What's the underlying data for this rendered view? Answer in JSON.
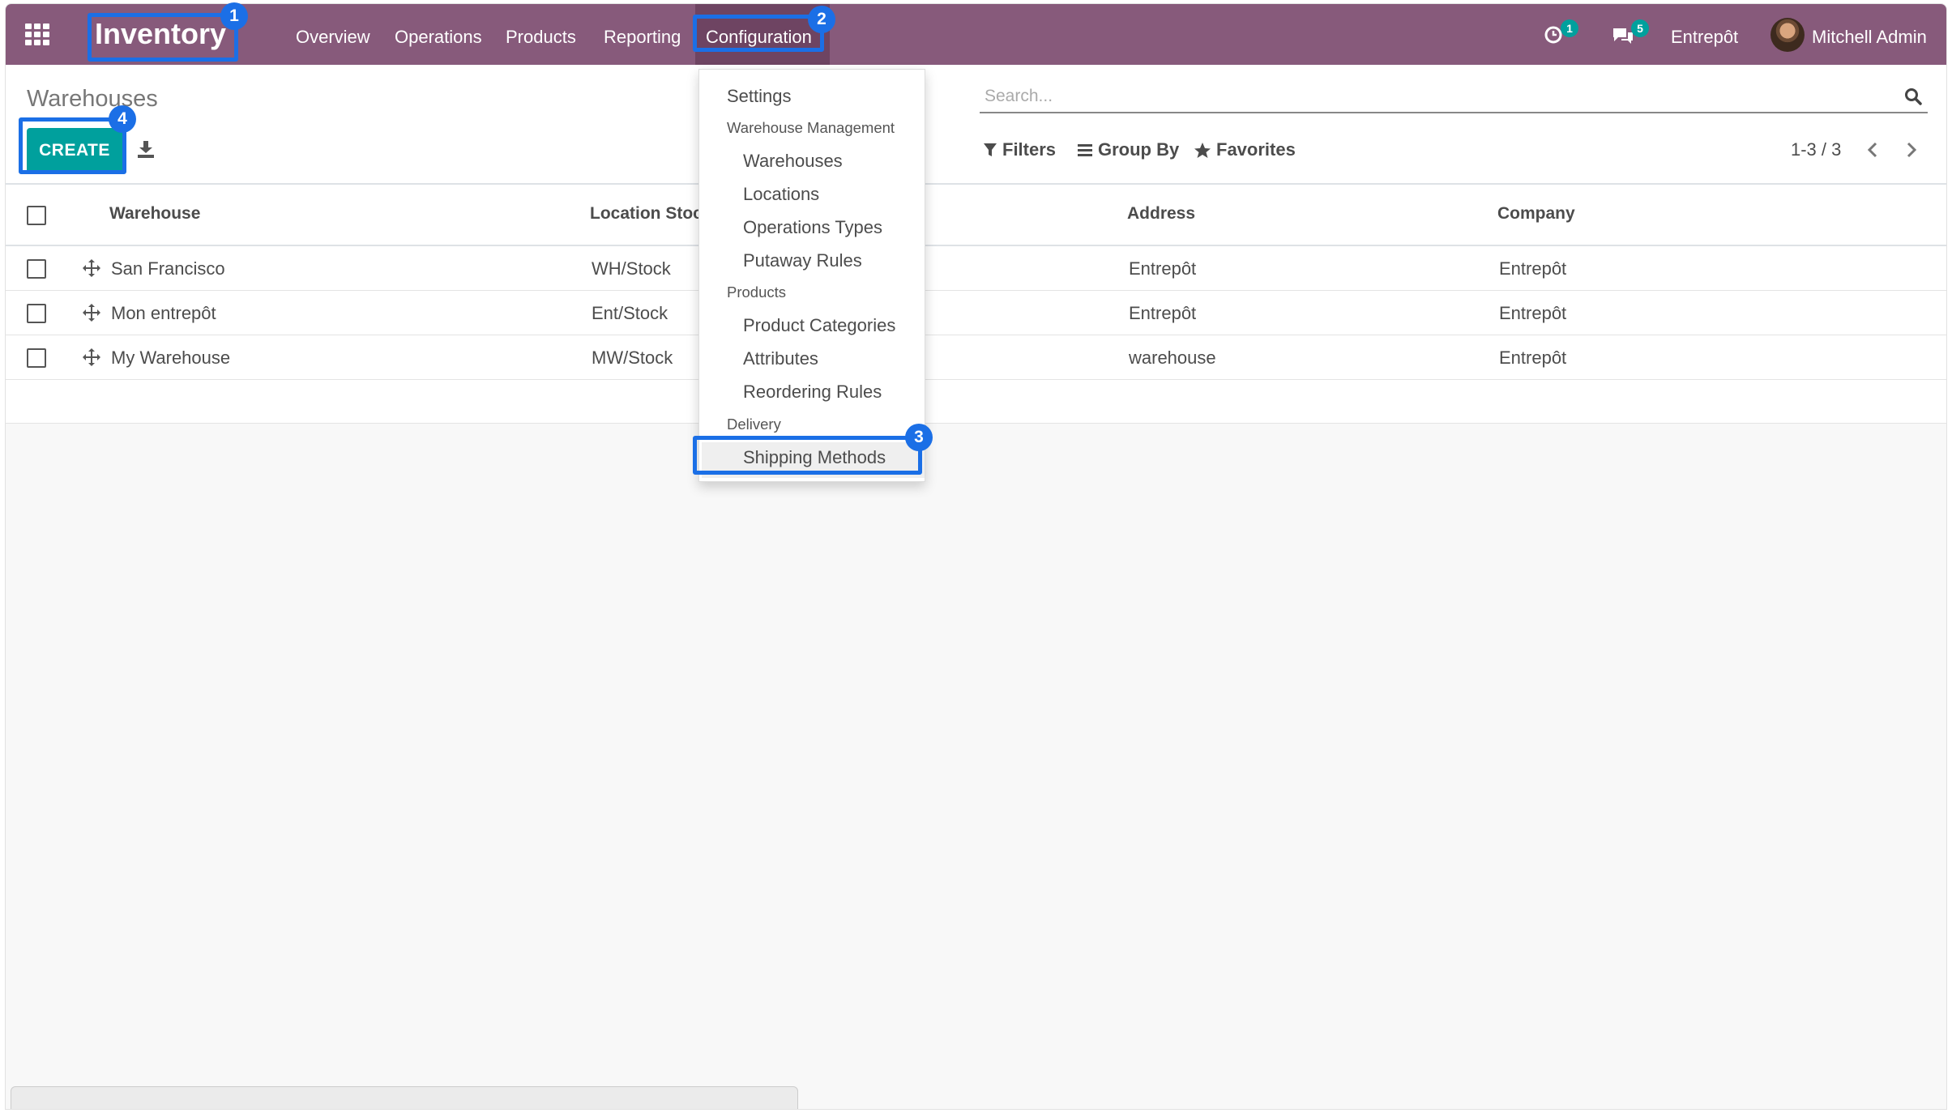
{
  "navbar": {
    "brand": "Inventory",
    "menu": [
      "Overview",
      "Operations",
      "Products",
      "Reporting",
      "Configuration"
    ],
    "activity_count": "1",
    "message_count": "5",
    "company": "Entrepôt",
    "user": "Mitchell Admin",
    "accent_color": "#875a7b"
  },
  "control_panel": {
    "title": "Warehouses",
    "create_label": "CREATE",
    "search_placeholder": "Search...",
    "filters_label": "Filters",
    "group_by_label": "Group By",
    "favorites_label": "Favorites",
    "pager": "1-3 / 3"
  },
  "table": {
    "columns": [
      "Warehouse",
      "Location Stock",
      "Address",
      "Company"
    ],
    "rows": [
      {
        "warehouse": "San Francisco",
        "location": "WH/Stock",
        "address": "Entrepôt",
        "company": "Entrepôt"
      },
      {
        "warehouse": "Mon entrepôt",
        "location": "Ent/Stock",
        "address": "Entrepôt",
        "company": "Entrepôt"
      },
      {
        "warehouse": "My Warehouse",
        "location": "MW/Stock",
        "address": "warehouse",
        "company": "Entrepôt"
      }
    ]
  },
  "config_menu": {
    "settings": "Settings",
    "section_warehouse": "Warehouse Management",
    "warehouses": "Warehouses",
    "locations": "Locations",
    "operation_types": "Operations Types",
    "putaway_rules": "Putaway Rules",
    "section_products": "Products",
    "product_categories": "Product Categories",
    "attributes": "Attributes",
    "reordering_rules": "Reordering Rules",
    "section_delivery": "Delivery",
    "shipping_methods": "Shipping Methods"
  },
  "annotations": [
    "1",
    "2",
    "3",
    "4"
  ],
  "colors": {
    "primary_button": "#00a09d",
    "annotation": "#1b6fe6"
  }
}
